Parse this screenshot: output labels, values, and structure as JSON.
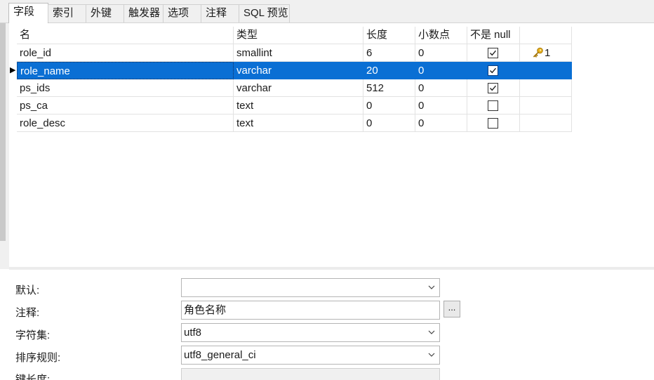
{
  "tabs": [
    {
      "label": "字段"
    },
    {
      "label": "索引"
    },
    {
      "label": "外键"
    },
    {
      "label": "触发器"
    },
    {
      "label": "选项"
    },
    {
      "label": "注释"
    },
    {
      "label": "SQL 预览"
    }
  ],
  "active_tab": "字段",
  "grid": {
    "columns": [
      "名",
      "类型",
      "长度",
      "小数点",
      "不是 null",
      ""
    ],
    "rows": [
      {
        "name": "role_id",
        "type": "smallint",
        "length": "6",
        "decimals": "0",
        "not_null": true,
        "key": "1"
      },
      {
        "name": "role_name",
        "type": "varchar",
        "length": "20",
        "decimals": "0",
        "not_null": true,
        "key": ""
      },
      {
        "name": "ps_ids",
        "type": "varchar",
        "length": "512",
        "decimals": "0",
        "not_null": true,
        "key": ""
      },
      {
        "name": "ps_ca",
        "type": "text",
        "length": "0",
        "decimals": "0",
        "not_null": false,
        "key": ""
      },
      {
        "name": "role_desc",
        "type": "text",
        "length": "0",
        "decimals": "0",
        "not_null": false,
        "key": ""
      }
    ],
    "selected_row": 1,
    "row_marker": "▶"
  },
  "properties": {
    "default_label": "默认:",
    "default_value": "",
    "comment_label": "注释:",
    "comment_value": "角色名称",
    "comment_button": "...",
    "charset_label": "字符集:",
    "charset_value": "utf8",
    "collation_label": "排序规则:",
    "collation_value": "utf8_general_ci",
    "key_length_label": "键长度:",
    "key_length_value": ""
  },
  "colors": {
    "selection": "#0a6fd4",
    "key_icon": "#d8a417"
  },
  "icons": {
    "checkbox_check": "check-icon",
    "primary_key": "key-icon",
    "dropdown": "chevron-down-icon",
    "row_pointer": "row-pointer-icon"
  }
}
